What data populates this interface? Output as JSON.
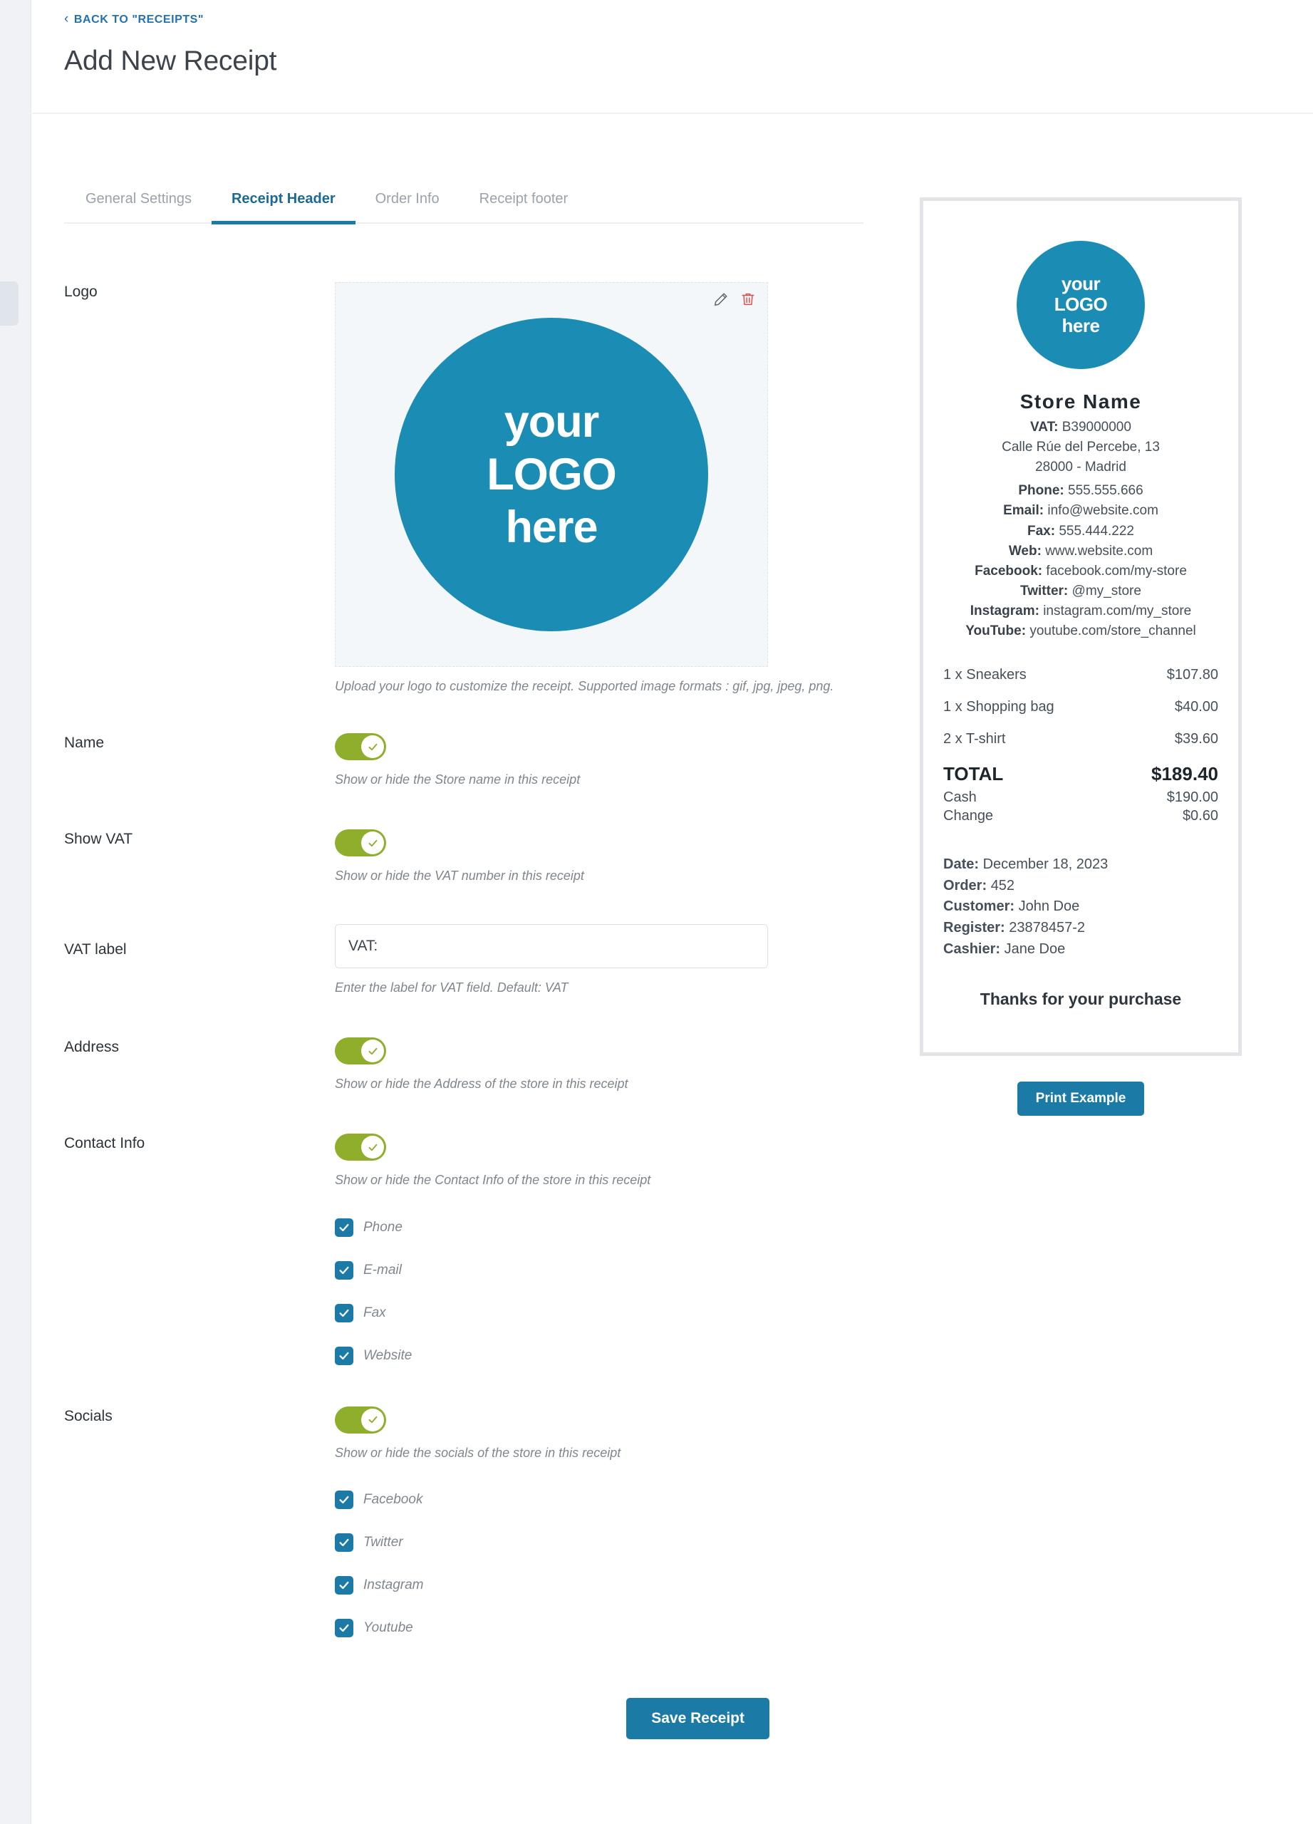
{
  "header": {
    "back_label": "BACK TO \"RECEIPTS\"",
    "back_chevron": "chevron-left-icon",
    "title": "Add New Receipt"
  },
  "tabs": [
    {
      "label": "General Settings",
      "active": false
    },
    {
      "label": "Receipt Header",
      "active": true
    },
    {
      "label": "Order Info",
      "active": false
    },
    {
      "label": "Receipt footer",
      "active": false
    }
  ],
  "form": {
    "logo": {
      "label": "Logo",
      "edit_icon": "pencil-icon",
      "delete_icon": "trash-icon",
      "image_text": {
        "l1": "your",
        "l2": "LOGO",
        "l3": "here"
      },
      "helper": "Upload your logo to customize the receipt. Supported image formats : gif, jpg, jpeg, png."
    },
    "name": {
      "label": "Name",
      "toggle_on": true,
      "helper": "Show or hide the Store name in this receipt"
    },
    "show_vat": {
      "label": "Show VAT",
      "toggle_on": true,
      "helper": "Show or hide the VAT number in this receipt"
    },
    "vat_label": {
      "label": "VAT label",
      "value": "VAT:",
      "placeholder": "VAT:",
      "helper": "Enter the label for VAT field. Default: VAT"
    },
    "address": {
      "label": "Address",
      "toggle_on": true,
      "helper": "Show or hide the Address of the store in this receipt"
    },
    "contact_info": {
      "label": "Contact Info",
      "toggle_on": true,
      "helper": "Show or hide the Contact Info of the store in this receipt",
      "options": [
        {
          "label": "Phone",
          "checked": true
        },
        {
          "label": "E-mail",
          "checked": true
        },
        {
          "label": "Fax",
          "checked": true
        },
        {
          "label": "Website",
          "checked": true
        }
      ]
    },
    "socials": {
      "label": "Socials",
      "toggle_on": true,
      "helper": "Show or hide the socials of the store in this receipt",
      "options": [
        {
          "label": "Facebook",
          "checked": true
        },
        {
          "label": "Twitter",
          "checked": true
        },
        {
          "label": "Instagram",
          "checked": true
        },
        {
          "label": "Youtube",
          "checked": true
        }
      ]
    },
    "save_label": "Save Receipt"
  },
  "preview": {
    "print_label": "Print Example",
    "logo_text": {
      "l1": "your",
      "l2": "LOGO",
      "l3": "here"
    },
    "store_name": "Store Name",
    "vat_label": "VAT:",
    "vat_value": "B39000000",
    "address_line1": "Calle Rúe del Percebe, 13",
    "address_line2": "28000 - Madrid",
    "contact": [
      {
        "label": "Phone:",
        "value": "555.555.666"
      },
      {
        "label": "Email:",
        "value": "info@website.com"
      },
      {
        "label": "Fax:",
        "value": "555.444.222"
      },
      {
        "label": "Web:",
        "value": "www.website.com"
      },
      {
        "label": "Facebook:",
        "value": "facebook.com/my-store"
      },
      {
        "label": "Twitter:",
        "value": "@my_store"
      },
      {
        "label": "Instagram:",
        "value": "instagram.com/my_store"
      },
      {
        "label": "YouTube:",
        "value": "youtube.com/store_channel"
      }
    ],
    "items": [
      {
        "name": "1 x Sneakers",
        "price": "$107.80"
      },
      {
        "name": "1 x Shopping bag",
        "price": "$40.00"
      },
      {
        "name": "2 x T-shirt",
        "price": "$39.60"
      }
    ],
    "total_label": "TOTAL",
    "total_value": "$189.40",
    "cash_label": "Cash",
    "cash_value": "$190.00",
    "change_label": "Change",
    "change_value": "$0.60",
    "meta": [
      {
        "label": "Date:",
        "value": "December 18, 2023"
      },
      {
        "label": "Order:",
        "value": "452"
      },
      {
        "label": "Customer:",
        "value": "John Doe"
      },
      {
        "label": "Register:",
        "value": "23878457-2"
      },
      {
        "label": "Cashier:",
        "value": "Jane Doe"
      }
    ],
    "thanks": "Thanks for your purchase"
  },
  "colors": {
    "accent_blue": "#1b7ba6",
    "link_blue": "#2271b1",
    "toggle_green": "#8fae2c",
    "logo_blue": "#1b8cb4",
    "trash_red": "#d94f4f"
  }
}
